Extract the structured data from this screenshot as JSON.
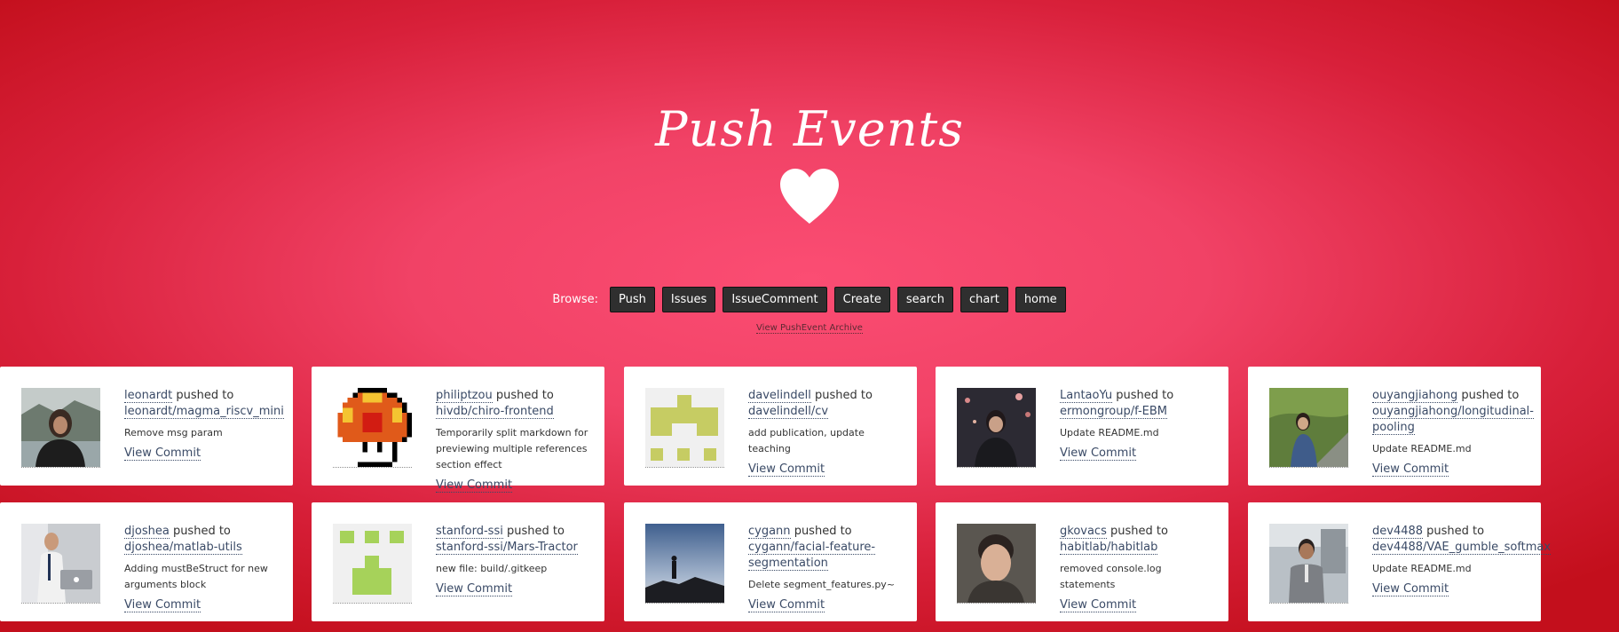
{
  "page": {
    "title": "Push Events",
    "browse_label": "Browse:",
    "archive_link": "View PushEvent Archive"
  },
  "colors": {
    "background_center": "#fb4d73",
    "background_edge": "#c30f1c",
    "button_bg": "#2f2f2f",
    "link": "#3a4a66"
  },
  "nav": {
    "buttons": [
      "Push",
      "Issues",
      "IssueComment",
      "Create",
      "search",
      "chart",
      "home"
    ]
  },
  "events": [
    {
      "user": "leonardt",
      "verb": "pushed to",
      "repo": "leonardt/magma_riscv_mini",
      "message": "Remove msg param",
      "action": "View Commit",
      "avatar": "photo-avatar"
    },
    {
      "user": "philiptzou",
      "verb": "pushed to",
      "repo": "hivdb/chiro-frontend",
      "message": "Temporarily split markdown for previewing multiple references section effect",
      "action": "View Commit",
      "avatar": "mushroom-pixel-avatar"
    },
    {
      "user": "davelindell",
      "verb": "pushed to",
      "repo": "davelindell/cv",
      "message": "add publication, update teaching",
      "action": "View Commit",
      "avatar": "identicon-avatar"
    },
    {
      "user": "LantaoYu",
      "verb": "pushed to",
      "repo": "ermongroup/f-EBM",
      "message": "Update README.md",
      "action": "View Commit",
      "avatar": "photo-avatar"
    },
    {
      "user": "ouyangjiahong",
      "verb": "pushed to",
      "repo": "ouyangjiahong/longitudinal-pooling",
      "message": "Update README.md",
      "action": "View Commit",
      "avatar": "photo-avatar"
    },
    {
      "user": "djoshea",
      "verb": "pushed to",
      "repo": "djoshea/matlab-utils",
      "message": "Adding mustBeStruct for new arguments block",
      "action": "View Commit",
      "avatar": "photo-avatar"
    },
    {
      "user": "stanford-ssi",
      "verb": "pushed to",
      "repo": "stanford-ssi/Mars-Tractor",
      "message": "new file: build/.gitkeep",
      "action": "View Commit",
      "avatar": "identicon-avatar"
    },
    {
      "user": "cygann",
      "verb": "pushed to",
      "repo": "cygann/facial-feature-segmentation",
      "message": "Delete segment_features.py~",
      "action": "View Commit",
      "avatar": "photo-avatar"
    },
    {
      "user": "gkovacs",
      "verb": "pushed to",
      "repo": "habitlab/habitlab",
      "message": "removed console.log statements",
      "action": "View Commit",
      "avatar": "photo-avatar"
    },
    {
      "user": "dev4488",
      "verb": "pushed to",
      "repo": "dev4488/VAE_gumble_softmax",
      "message": "Update README.md",
      "action": "View Commit",
      "avatar": "photo-avatar"
    }
  ]
}
